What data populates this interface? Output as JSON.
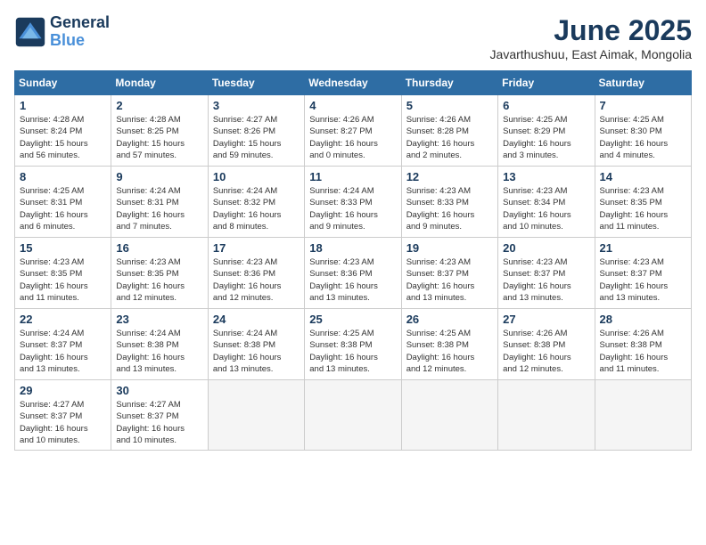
{
  "header": {
    "logo_line1": "General",
    "logo_line2": "Blue",
    "month_title": "June 2025",
    "location": "Javarthushuu, East Aimak, Mongolia"
  },
  "days_of_week": [
    "Sunday",
    "Monday",
    "Tuesday",
    "Wednesday",
    "Thursday",
    "Friday",
    "Saturday"
  ],
  "weeks": [
    [
      {
        "day": "1",
        "info": "Sunrise: 4:28 AM\nSunset: 8:24 PM\nDaylight: 15 hours\nand 56 minutes."
      },
      {
        "day": "2",
        "info": "Sunrise: 4:28 AM\nSunset: 8:25 PM\nDaylight: 15 hours\nand 57 minutes."
      },
      {
        "day": "3",
        "info": "Sunrise: 4:27 AM\nSunset: 8:26 PM\nDaylight: 15 hours\nand 59 minutes."
      },
      {
        "day": "4",
        "info": "Sunrise: 4:26 AM\nSunset: 8:27 PM\nDaylight: 16 hours\nand 0 minutes."
      },
      {
        "day": "5",
        "info": "Sunrise: 4:26 AM\nSunset: 8:28 PM\nDaylight: 16 hours\nand 2 minutes."
      },
      {
        "day": "6",
        "info": "Sunrise: 4:25 AM\nSunset: 8:29 PM\nDaylight: 16 hours\nand 3 minutes."
      },
      {
        "day": "7",
        "info": "Sunrise: 4:25 AM\nSunset: 8:30 PM\nDaylight: 16 hours\nand 4 minutes."
      }
    ],
    [
      {
        "day": "8",
        "info": "Sunrise: 4:25 AM\nSunset: 8:31 PM\nDaylight: 16 hours\nand 6 minutes."
      },
      {
        "day": "9",
        "info": "Sunrise: 4:24 AM\nSunset: 8:31 PM\nDaylight: 16 hours\nand 7 minutes."
      },
      {
        "day": "10",
        "info": "Sunrise: 4:24 AM\nSunset: 8:32 PM\nDaylight: 16 hours\nand 8 minutes."
      },
      {
        "day": "11",
        "info": "Sunrise: 4:24 AM\nSunset: 8:33 PM\nDaylight: 16 hours\nand 9 minutes."
      },
      {
        "day": "12",
        "info": "Sunrise: 4:23 AM\nSunset: 8:33 PM\nDaylight: 16 hours\nand 9 minutes."
      },
      {
        "day": "13",
        "info": "Sunrise: 4:23 AM\nSunset: 8:34 PM\nDaylight: 16 hours\nand 10 minutes."
      },
      {
        "day": "14",
        "info": "Sunrise: 4:23 AM\nSunset: 8:35 PM\nDaylight: 16 hours\nand 11 minutes."
      }
    ],
    [
      {
        "day": "15",
        "info": "Sunrise: 4:23 AM\nSunset: 8:35 PM\nDaylight: 16 hours\nand 11 minutes."
      },
      {
        "day": "16",
        "info": "Sunrise: 4:23 AM\nSunset: 8:35 PM\nDaylight: 16 hours\nand 12 minutes."
      },
      {
        "day": "17",
        "info": "Sunrise: 4:23 AM\nSunset: 8:36 PM\nDaylight: 16 hours\nand 12 minutes."
      },
      {
        "day": "18",
        "info": "Sunrise: 4:23 AM\nSunset: 8:36 PM\nDaylight: 16 hours\nand 13 minutes."
      },
      {
        "day": "19",
        "info": "Sunrise: 4:23 AM\nSunset: 8:37 PM\nDaylight: 16 hours\nand 13 minutes."
      },
      {
        "day": "20",
        "info": "Sunrise: 4:23 AM\nSunset: 8:37 PM\nDaylight: 16 hours\nand 13 minutes."
      },
      {
        "day": "21",
        "info": "Sunrise: 4:23 AM\nSunset: 8:37 PM\nDaylight: 16 hours\nand 13 minutes."
      }
    ],
    [
      {
        "day": "22",
        "info": "Sunrise: 4:24 AM\nSunset: 8:37 PM\nDaylight: 16 hours\nand 13 minutes."
      },
      {
        "day": "23",
        "info": "Sunrise: 4:24 AM\nSunset: 8:38 PM\nDaylight: 16 hours\nand 13 minutes."
      },
      {
        "day": "24",
        "info": "Sunrise: 4:24 AM\nSunset: 8:38 PM\nDaylight: 16 hours\nand 13 minutes."
      },
      {
        "day": "25",
        "info": "Sunrise: 4:25 AM\nSunset: 8:38 PM\nDaylight: 16 hours\nand 13 minutes."
      },
      {
        "day": "26",
        "info": "Sunrise: 4:25 AM\nSunset: 8:38 PM\nDaylight: 16 hours\nand 12 minutes."
      },
      {
        "day": "27",
        "info": "Sunrise: 4:26 AM\nSunset: 8:38 PM\nDaylight: 16 hours\nand 12 minutes."
      },
      {
        "day": "28",
        "info": "Sunrise: 4:26 AM\nSunset: 8:38 PM\nDaylight: 16 hours\nand 11 minutes."
      }
    ],
    [
      {
        "day": "29",
        "info": "Sunrise: 4:27 AM\nSunset: 8:37 PM\nDaylight: 16 hours\nand 10 minutes."
      },
      {
        "day": "30",
        "info": "Sunrise: 4:27 AM\nSunset: 8:37 PM\nDaylight: 16 hours\nand 10 minutes."
      },
      {
        "day": "",
        "info": ""
      },
      {
        "day": "",
        "info": ""
      },
      {
        "day": "",
        "info": ""
      },
      {
        "day": "",
        "info": ""
      },
      {
        "day": "",
        "info": ""
      }
    ]
  ]
}
